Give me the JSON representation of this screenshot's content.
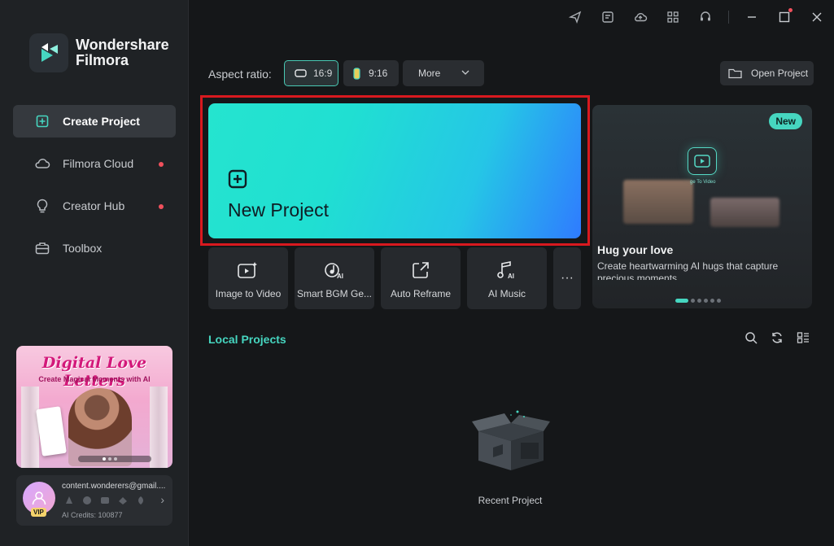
{
  "brand": {
    "name": "Wondershare Filmora"
  },
  "sidebar": {
    "items": [
      {
        "label": "Create Project",
        "active": true
      },
      {
        "label": "Filmora Cloud",
        "dot": true
      },
      {
        "label": "Creator Hub",
        "dot": true
      },
      {
        "label": "Toolbox"
      }
    ],
    "promo": {
      "title": "Digital Love Letters",
      "subtitle": "Create Magical Moments with AI"
    },
    "account": {
      "email": "content.wonderers@gmail....",
      "badge": "VIP",
      "credits": "AI Credits: 100877"
    }
  },
  "toolbar": {
    "aspect_label": "Aspect ratio:",
    "ratios": [
      {
        "label": "16:9",
        "selected": true
      },
      {
        "label": "9:16"
      }
    ],
    "more_label": "More",
    "open_project": "Open Project"
  },
  "new_project": {
    "label": "New Project"
  },
  "tools": [
    {
      "label": "Image to Video",
      "icon": "image-to-video-icon"
    },
    {
      "label": "Smart BGM Ge...",
      "icon": "smart-bgm-icon"
    },
    {
      "label": "Auto Reframe",
      "icon": "auto-reframe-icon"
    },
    {
      "label": "AI Music",
      "icon": "ai-music-icon"
    }
  ],
  "feature": {
    "badge": "New",
    "overlay_text": "ge To Video",
    "title": "Hug your love",
    "description": "Create heartwarming AI hugs that capture precious moments.",
    "page_index": 1,
    "page_count": 6
  },
  "local_projects": {
    "title": "Local Projects",
    "empty_label": "Recent Project"
  },
  "colors": {
    "accent": "#46d6c0",
    "highlight": "#d8191f",
    "notify": "#f0505c"
  }
}
